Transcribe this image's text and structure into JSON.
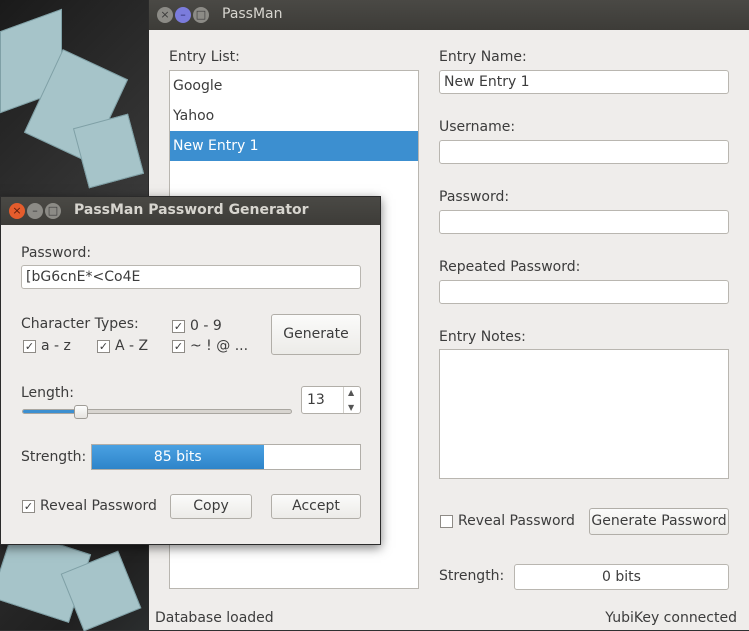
{
  "main_window": {
    "title": "PassMan",
    "entry_list_label": "Entry List:",
    "entries": [
      "Google",
      "Yahoo",
      "New Entry 1"
    ],
    "selected_entry": "New Entry 1",
    "entry_name_label": "Entry Name:",
    "entry_name_value": "New Entry 1",
    "username_label": "Username:",
    "username_value": "",
    "password_label": "Password:",
    "password_value": "",
    "repeated_password_label": "Repeated Password:",
    "repeated_password_value": "",
    "entry_notes_label": "Entry Notes:",
    "entry_notes_value": "",
    "reveal_password_label": "Reveal Password",
    "reveal_password_checked": false,
    "generate_password_label": "Generate Password",
    "strength_label": "Strength:",
    "strength_value": "0 bits",
    "status_left": "Database loaded",
    "status_right": "YubiKey connected"
  },
  "generator": {
    "title": "PassMan Password Generator",
    "password_label": "Password:",
    "password_value": "[bG6cnE*<Co4E",
    "char_types_label": "Character Types:",
    "types": {
      "digits": {
        "label": "0 - 9",
        "checked": true
      },
      "lower": {
        "label": "a - z",
        "checked": true
      },
      "upper": {
        "label": "A - Z",
        "checked": true
      },
      "symbols": {
        "label": "~ ! @ ...",
        "checked": true
      }
    },
    "generate_label": "Generate",
    "length_label": "Length:",
    "length_value": "13",
    "length_slider_fraction": 0.22,
    "strength_label": "Strength:",
    "strength_value": "85 bits",
    "strength_fraction": 0.64,
    "reveal_password_label": "Reveal Password",
    "reveal_password_checked": true,
    "copy_label": "Copy",
    "accept_label": "Accept"
  },
  "icons": {
    "close": "close-icon",
    "minimize": "minimize-icon",
    "maximize": "maximize-icon",
    "check": "✓"
  },
  "colors": {
    "accent": "#3c8fd0",
    "window_bg": "#efedeb",
    "titlebar": "#3d3c38"
  }
}
